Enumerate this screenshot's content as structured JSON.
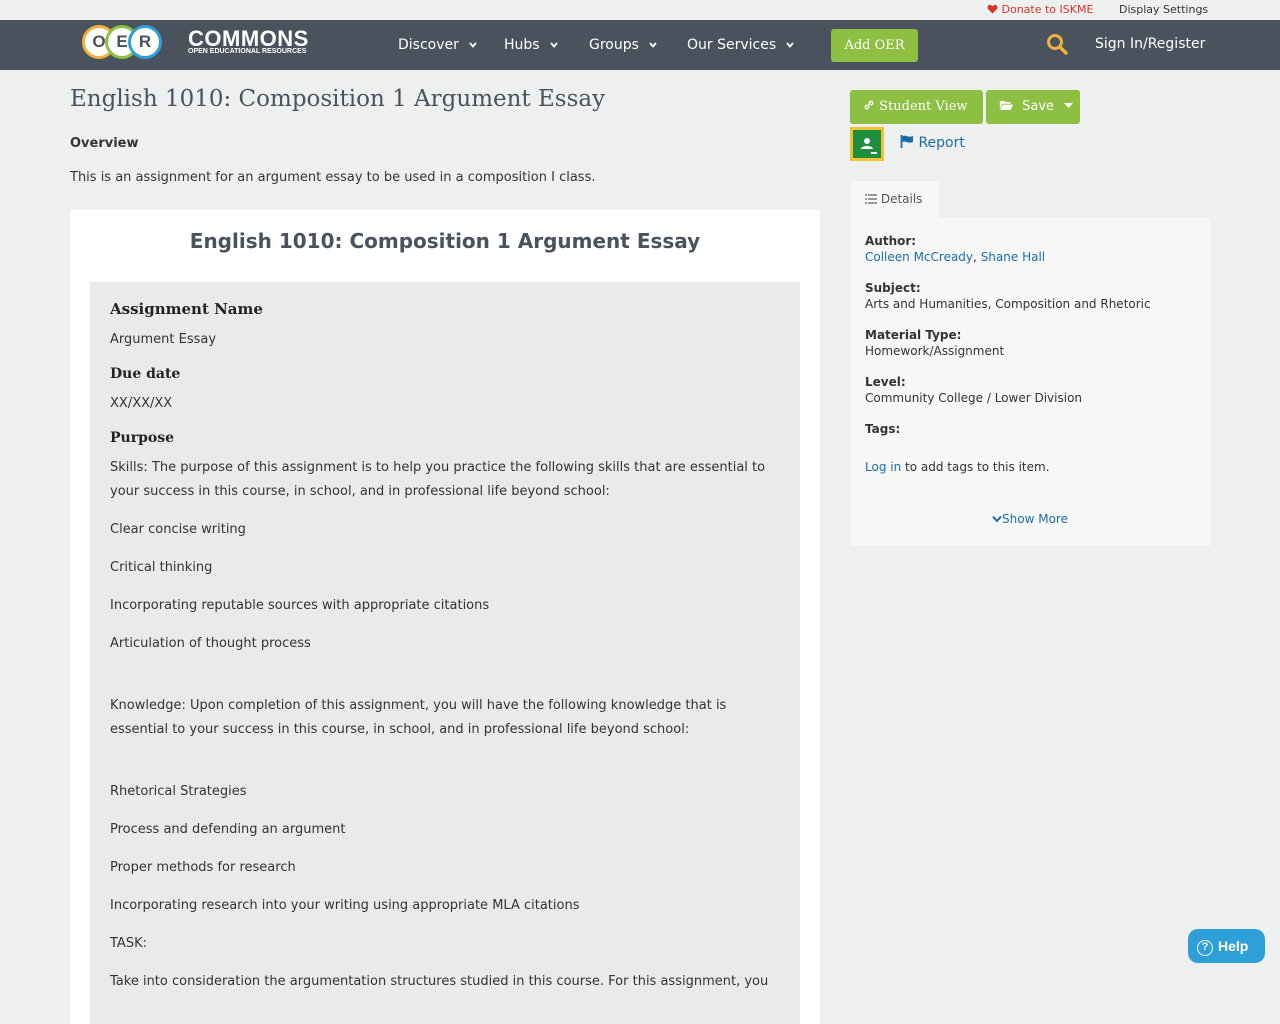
{
  "utility": {
    "donate": "Donate to ISKME",
    "display_settings": "Display Settings"
  },
  "logo": {
    "letters": [
      "O",
      "E",
      "R"
    ],
    "word": "COMMONS",
    "subtitle": "OPEN EDUCATIONAL RESOURCES"
  },
  "nav": {
    "items": [
      {
        "label": "Discover"
      },
      {
        "label": "Hubs"
      },
      {
        "label": "Groups"
      },
      {
        "label": "Our Services"
      }
    ],
    "add_oer": "Add OER",
    "sign_in": "Sign In/Register"
  },
  "resource": {
    "title": "English 1010: Composition 1 Argument Essay",
    "overview_label": "Overview",
    "overview_text": "This is an assignment for an argument essay to be used in a composition I class."
  },
  "document": {
    "title": "English 1010: Composition 1 Argument Essay",
    "assignment_name_heading": "Assignment Name",
    "assignment_name": "Argument Essay",
    "due_date_heading": "Due date",
    "due_date": "XX/XX/XX",
    "purpose_heading": "Purpose",
    "skills_intro": "Skills: The purpose of this assignment is to help you practice the following skills that are essential to your success in this course, in school, and in professional life beyond school:",
    "skills": [
      "Clear concise writing",
      "Critical thinking",
      "Incorporating reputable sources with appropriate citations",
      "Articulation of thought process"
    ],
    "knowledge_intro": "Knowledge: Upon completion of this assignment, you will have the following knowledge that is essential to your success in this course, in school, and in professional life beyond school:",
    "knowledge": [
      "Rhetorical Strategies",
      "Process and defending an argument",
      "Proper methods for research",
      "Incorporating research into your writing using appropriate MLA citations"
    ],
    "task_label": "TASK:",
    "task_text": "Take into consideration the argumentation structures studied in this course. For this assignment, you"
  },
  "actions": {
    "student_view": "Student View",
    "save": "Save",
    "report": "Report"
  },
  "details": {
    "tab": "Details",
    "author_label": "Author:",
    "authors": [
      "Colleen McCready",
      "Shane Hall"
    ],
    "author_sep": ",",
    "subject_label": "Subject:",
    "subject": "Arts and Humanities, Composition and Rhetoric",
    "material_label": "Material Type:",
    "material": "Homework/Assignment",
    "level_label": "Level:",
    "level": "Community College / Lower Division",
    "tags_label": "Tags:",
    "login_link": "Log in",
    "login_rest": " to add tags to this item.",
    "show_more": "Show More"
  },
  "help": {
    "label": "Help"
  },
  "colors": {
    "nav_bg": "#4a525d",
    "accent_green": "#8cbf42",
    "link_blue": "#1a6ea8",
    "donate_red": "#d9332b",
    "help_blue": "#2f9fd8"
  }
}
